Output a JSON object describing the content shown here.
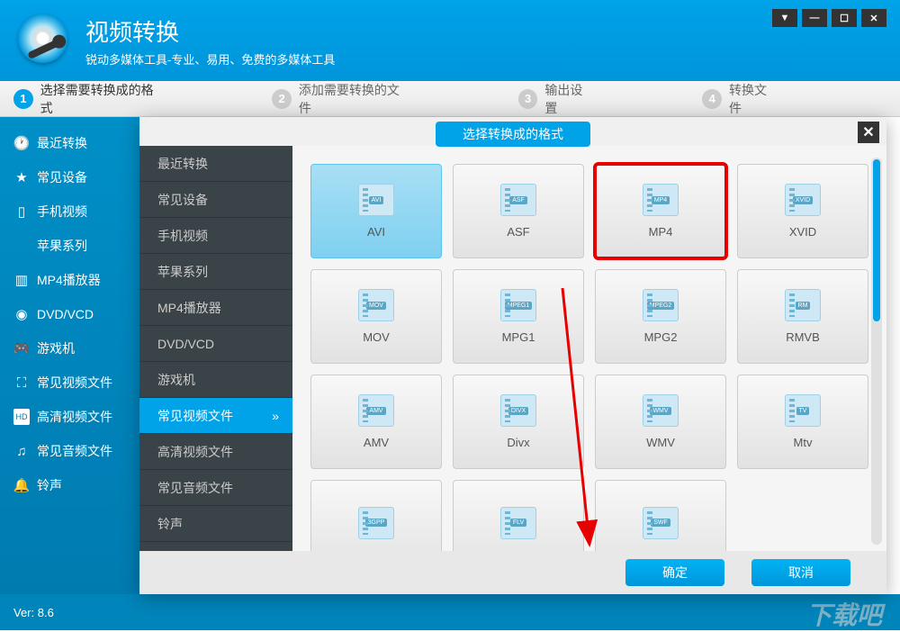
{
  "header": {
    "title": "视频转换",
    "subtitle": "锐动多媒体工具-专业、易用、免费的多媒体工具"
  },
  "windowControls": [
    "▼",
    "—",
    "☐",
    "✕"
  ],
  "steps": [
    {
      "num": "1",
      "label": "选择需要转换成的格式",
      "active": true
    },
    {
      "num": "2",
      "label": "添加需要转换的文件",
      "active": false
    },
    {
      "num": "3",
      "label": "输出设置",
      "active": false
    },
    {
      "num": "4",
      "label": "转换文件",
      "active": false
    }
  ],
  "sidebarMain": {
    "items": [
      {
        "icon": "clock",
        "label": "最近转换"
      },
      {
        "icon": "star",
        "label": "常见设备"
      },
      {
        "icon": "phone",
        "label": "手机视频"
      },
      {
        "icon": "apple",
        "label": "苹果系列"
      },
      {
        "icon": "bars",
        "label": "MP4播放器"
      },
      {
        "icon": "disc",
        "label": "DVD/VCD"
      },
      {
        "icon": "gamepad",
        "label": "游戏机"
      },
      {
        "icon": "film",
        "label": "常见视频文件"
      },
      {
        "icon": "hd",
        "label": "高清视频文件"
      },
      {
        "icon": "music",
        "label": "常见音频文件"
      },
      {
        "icon": "bell",
        "label": "铃声"
      }
    ]
  },
  "dialog": {
    "title": "选择转换成的格式",
    "sidebar": [
      {
        "label": "最近转换",
        "selected": false
      },
      {
        "label": "常见设备",
        "selected": false
      },
      {
        "label": "手机视频",
        "selected": false
      },
      {
        "label": "苹果系列",
        "selected": false
      },
      {
        "label": "MP4播放器",
        "selected": false
      },
      {
        "label": "DVD/VCD",
        "selected": false
      },
      {
        "label": "游戏机",
        "selected": false
      },
      {
        "label": "常见视频文件",
        "selected": true
      },
      {
        "label": "高清视频文件",
        "selected": false
      },
      {
        "label": "常见音频文件",
        "selected": false
      },
      {
        "label": "铃声",
        "selected": false
      }
    ],
    "formats": [
      {
        "label": "AVI",
        "badge": "AVI",
        "selected": true,
        "highlighted": false
      },
      {
        "label": "ASF",
        "badge": "ASF",
        "selected": false,
        "highlighted": false
      },
      {
        "label": "MP4",
        "badge": "MP4",
        "selected": false,
        "highlighted": true
      },
      {
        "label": "XVID",
        "badge": "XVID",
        "selected": false,
        "highlighted": false
      },
      {
        "label": "MOV",
        "badge": "MOV",
        "selected": false,
        "highlighted": false
      },
      {
        "label": "MPG1",
        "badge": "MPEG1",
        "selected": false,
        "highlighted": false
      },
      {
        "label": "MPG2",
        "badge": "MPEG2",
        "selected": false,
        "highlighted": false
      },
      {
        "label": "RMVB",
        "badge": "RM",
        "selected": false,
        "highlighted": false
      },
      {
        "label": "AMV",
        "badge": "AMV",
        "selected": false,
        "highlighted": false
      },
      {
        "label": "Divx",
        "badge": "DIVX",
        "selected": false,
        "highlighted": false
      },
      {
        "label": "WMV",
        "badge": "WMV",
        "selected": false,
        "highlighted": false
      },
      {
        "label": "Mtv",
        "badge": "TV",
        "selected": false,
        "highlighted": false
      },
      {
        "label": "",
        "badge": "3GPP",
        "selected": false,
        "highlighted": false
      },
      {
        "label": "",
        "badge": "FLV",
        "selected": false,
        "highlighted": false
      },
      {
        "label": "",
        "badge": "SWF",
        "selected": false,
        "highlighted": false
      }
    ],
    "buttons": {
      "ok": "确定",
      "cancel": "取消"
    }
  },
  "footer": {
    "version": "Ver: 8.6"
  },
  "watermark": "下载吧"
}
